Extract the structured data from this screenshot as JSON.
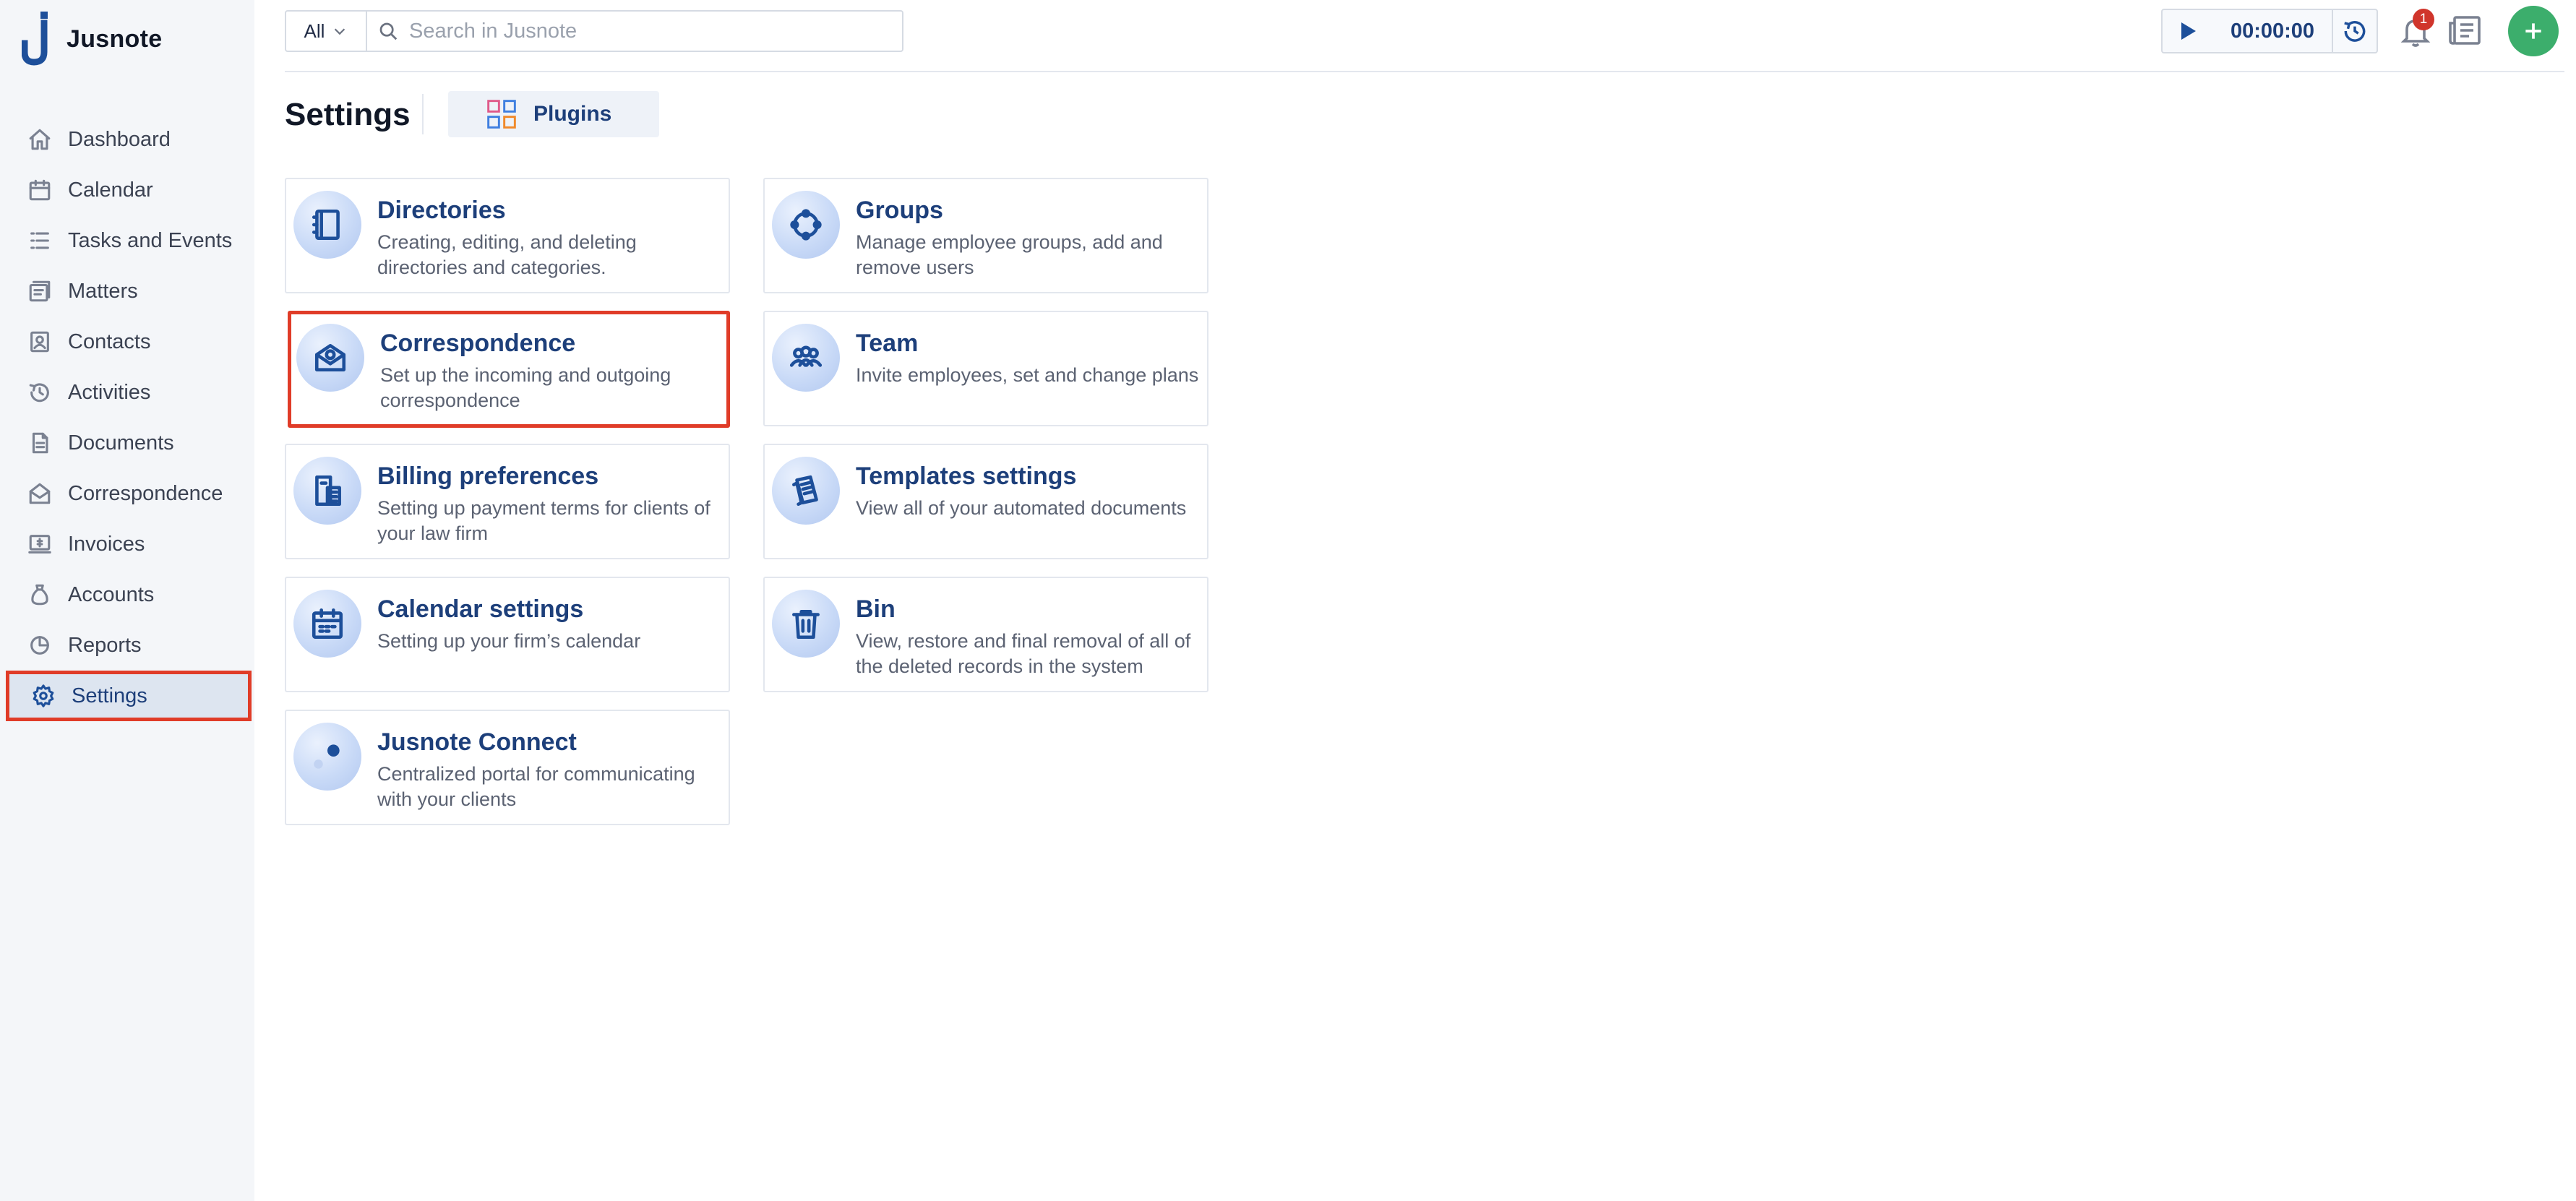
{
  "app": {
    "name": "Jusnote"
  },
  "sidebar": {
    "items": [
      {
        "label": "Dashboard",
        "icon": "home-icon"
      },
      {
        "label": "Calendar",
        "icon": "calendar-icon"
      },
      {
        "label": "Tasks and Events",
        "icon": "tasks-icon"
      },
      {
        "label": "Matters",
        "icon": "matters-icon"
      },
      {
        "label": "Contacts",
        "icon": "contacts-icon"
      },
      {
        "label": "Activities",
        "icon": "activities-icon"
      },
      {
        "label": "Documents",
        "icon": "documents-icon"
      },
      {
        "label": "Correspondence",
        "icon": "correspondence-icon"
      },
      {
        "label": "Invoices",
        "icon": "invoices-icon"
      },
      {
        "label": "Accounts",
        "icon": "accounts-icon"
      },
      {
        "label": "Reports",
        "icon": "reports-icon"
      },
      {
        "label": "Settings",
        "icon": "gear-icon",
        "active": true
      }
    ]
  },
  "topbar": {
    "scope": "All",
    "search_placeholder": "Search in Jusnote",
    "timer": "00:00:00",
    "notifications_count": "1"
  },
  "main": {
    "title": "Settings",
    "plugins_label": "Plugins",
    "cards": [
      {
        "title": "Directories",
        "desc": "Creating, editing, and deleting directories and categories.",
        "icon": "book-icon"
      },
      {
        "title": "Groups",
        "desc": "Manage employee groups, add and remove users",
        "icon": "groups-icon"
      },
      {
        "title": "Correspondence",
        "desc": "Set up the incoming and outgoing correspondence",
        "icon": "mail-icon"
      },
      {
        "title": "Team",
        "desc": "Invite employees, set and change plans",
        "icon": "team-icon"
      },
      {
        "title": "Billing preferences",
        "desc": "Setting up payment terms for clients of your law firm",
        "icon": "billing-icon"
      },
      {
        "title": "Templates settings",
        "desc": "View all of your automated documents",
        "icon": "templates-icon"
      },
      {
        "title": "Calendar settings",
        "desc": "Setting up your firm’s calendar",
        "icon": "calendar-icon"
      },
      {
        "title": "Bin",
        "desc": "View, restore and final removal of all of the deleted records in the system",
        "icon": "trash-icon"
      },
      {
        "title": "Jusnote Connect",
        "desc": "Centralized portal for communicating with your clients",
        "icon": "connect-icon"
      }
    ]
  },
  "colors": {
    "accent": "#1d3f7a",
    "highlight": "#e03c28",
    "add_button": "#3cae6c",
    "badge": "#d0352b"
  }
}
